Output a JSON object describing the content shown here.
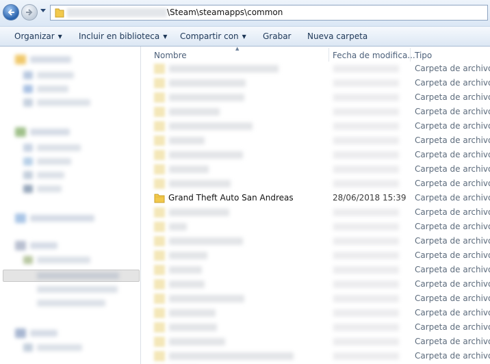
{
  "address": {
    "path_text": "\\Steam\\steamapps\\common"
  },
  "toolbar": {
    "organize": "Organizar",
    "include_library": "Incluir en biblioteca",
    "share_with": "Compartir con",
    "burn": "Grabar",
    "new_folder": "Nueva carpeta"
  },
  "columns": {
    "name": "Nombre",
    "date_modified": "Fecha de modifica...",
    "type": "Tipo"
  },
  "rows": [
    {
      "type": "Carpeta de archivos"
    },
    {
      "type": "Carpeta de archivos"
    },
    {
      "type": "Carpeta de archivos"
    },
    {
      "type": "Carpeta de archivos"
    },
    {
      "type": "Carpeta de archivos"
    },
    {
      "type": "Carpeta de archivos"
    },
    {
      "type": "Carpeta de archivos"
    },
    {
      "type": "Carpeta de archivos"
    },
    {
      "type": "Carpeta de archivos"
    },
    {
      "name": "Grand Theft Auto San Andreas",
      "date": "28/06/2018 15:39",
      "type": "Carpeta de archivos"
    },
    {
      "type": "Carpeta de archivos"
    },
    {
      "type": "Carpeta de archivos"
    },
    {
      "type": "Carpeta de archivos"
    },
    {
      "type": "Carpeta de archivos"
    },
    {
      "type": "Carpeta de archivos"
    },
    {
      "type": "Carpeta de archivos"
    },
    {
      "type": "Carpeta de archivos"
    },
    {
      "type": "Carpeta de archivos"
    },
    {
      "type": "Carpeta de archivos"
    },
    {
      "type": "Carpeta de archivos"
    },
    {
      "type": "Carpeta de archivos"
    },
    {
      "type": "Carpeta de archivos"
    }
  ],
  "icons": {
    "back": "back-arrow-icon",
    "forward": "forward-arrow-icon",
    "recent": "chevron-down-icon",
    "folder": "folder-icon"
  },
  "colors": {
    "toolbar_text": "#1c3656",
    "folder": "#f2c94c",
    "header_text": "#4c607a"
  }
}
